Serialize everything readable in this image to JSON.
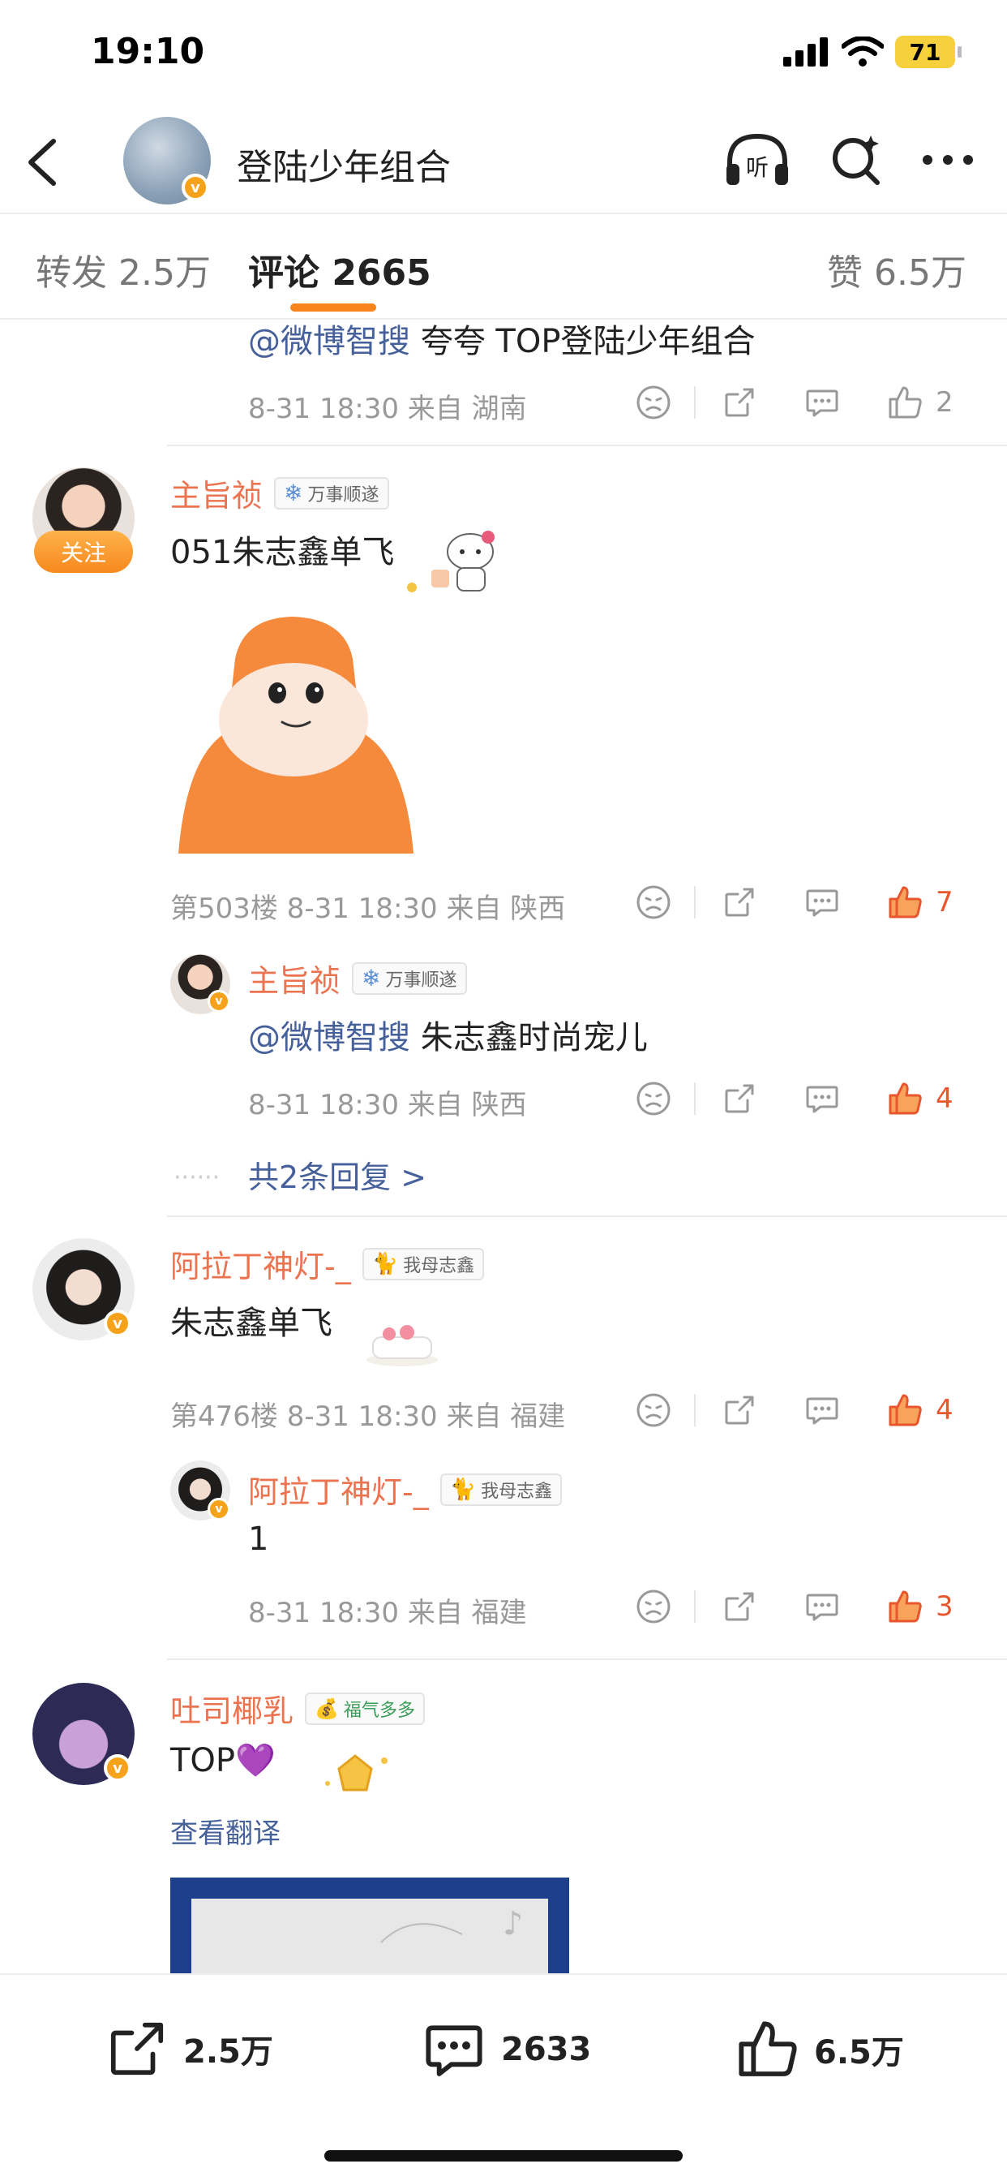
{
  "status_bar": {
    "time": "19:10",
    "battery": "71"
  },
  "nav": {
    "title": "登陆少年组合",
    "verified": "v"
  },
  "tabs": [
    {
      "label": "转发 2.5万"
    },
    {
      "label": "评论 2665"
    },
    {
      "label": "赞 6.5万"
    }
  ],
  "top_reply": {
    "mention": "@微博智搜",
    "text": " 夸夸 TOP登陆少年组合",
    "meta": "8-31 18:30 来自 湖南",
    "likes": "2"
  },
  "comment1": {
    "follow_label": "关注",
    "name": "主旨祯",
    "badge": "万事顺遂",
    "text": "051朱志鑫单飞",
    "meta": "第503楼 8-31 18:30 来自 陕西",
    "likes": "7",
    "reply": {
      "name": "主旨祯",
      "badge": "万事顺遂",
      "mention": "@微博智搜",
      "text": " 朱志鑫时尚宠儿",
      "meta": "8-31 18:30 来自 陕西",
      "likes": "4"
    },
    "more_replies": "共2条回复 >"
  },
  "comment2": {
    "name": "阿拉丁神灯-_",
    "badge": "我母志鑫",
    "text": "朱志鑫单飞",
    "meta": "第476楼 8-31 18:30 来自 福建",
    "likes": "4",
    "reply": {
      "name": "阿拉丁神灯-_",
      "badge": "我母志鑫",
      "text": "1",
      "meta": "8-31 18:30 来自 福建",
      "likes": "3"
    }
  },
  "comment3": {
    "name": "吐司椰乳",
    "badge": "福气多多",
    "text": "TOP💜",
    "translate": "查看翻译"
  },
  "bottom_bar": {
    "repost": "2.5万",
    "comment": "2633",
    "like": "6.5万"
  },
  "colors": {
    "accent": "#f7851b",
    "name": "#eb7350",
    "mention": "#46609b",
    "liked": "#e8562e"
  }
}
